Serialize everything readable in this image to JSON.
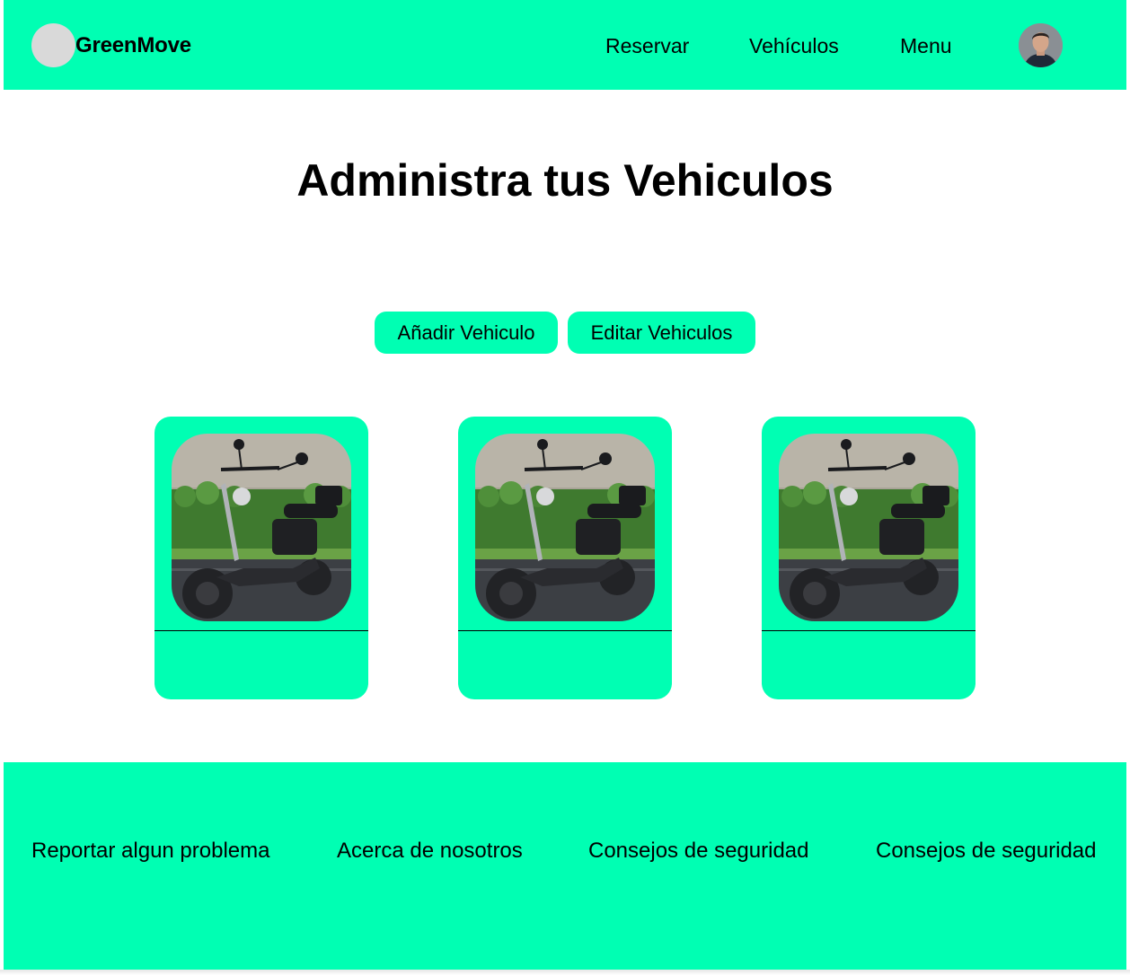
{
  "header": {
    "brand": "GreenMove",
    "nav": [
      "Reservar",
      "Vehículos",
      "Menu"
    ]
  },
  "main": {
    "title": "Administra tus Vehiculos",
    "buttons": {
      "add": "Añadir Vehiculo",
      "edit": "Editar Vehiculos"
    },
    "vehicles": [
      {
        "image": "electric-scooter-photo"
      },
      {
        "image": "electric-scooter-photo"
      },
      {
        "image": "electric-scooter-photo"
      }
    ]
  },
  "footer": {
    "links": [
      "Reportar algun problema",
      "Acerca de nosotros",
      "Consejos de seguridad",
      "Consejos de seguridad"
    ]
  },
  "colors": {
    "accent": "#00ffb3",
    "logo_placeholder": "#d9d9d9",
    "text": "#000000"
  }
}
